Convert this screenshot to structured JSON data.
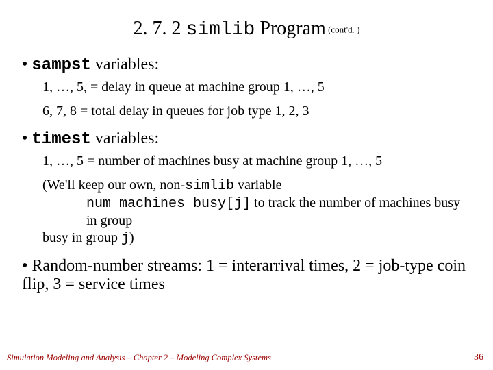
{
  "title": {
    "section": "2. 7. 2 ",
    "code": "simlib",
    "rest": " Program",
    "contd": " (cont'd. )"
  },
  "bullets": {
    "sampst": {
      "code": "sampst",
      "label": " variables:",
      "line1": "1, …, 5, = delay in queue at machine group 1, …, 5",
      "line2": "6, 7, 8 = total delay in queues for job type 1, 2, 3"
    },
    "timest": {
      "code": "timest",
      "label": " variables:",
      "line1": "1, …, 5 = number of machines busy at machine group 1, …, 5",
      "line2a": "(We'll keep our own, non-",
      "line2code1": "simlib",
      "line2b": " variable ",
      "line2code2": "num_machines_busy[j]",
      "line2c": " to track the number of machines busy in group ",
      "line2code3": "j",
      "line2d": ")"
    },
    "random": {
      "text": "Random-number streams:  1 = interarrival times, 2 = job-type coin flip, 3 = service times"
    }
  },
  "footer": "Simulation Modeling and Analysis – Chapter 2 – Modeling Complex Systems",
  "page": "36"
}
